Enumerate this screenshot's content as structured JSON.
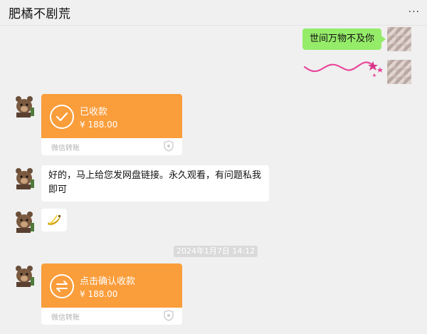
{
  "header": {
    "title": "肥橘不剧荒",
    "more_icon": "more-dots-icon",
    "more_label": "···"
  },
  "messages": {
    "sent_text": "世间万物不及你",
    "sticker_icon": "pink-star-squiggle-icon",
    "transfer1": {
      "label": "已收款",
      "amount": "¥ 188.00",
      "footer": "微信转账",
      "status_icon": "check-circle-icon"
    },
    "reply_text": "好的，马上给您发网盘链接。永久观看，有问题私我即可",
    "emoji_icon": "banana-emoji-icon",
    "timestamp": "2024年1月7日 14:12",
    "transfer2": {
      "label": "点击确认收款",
      "amount": "¥ 188.00",
      "footer": "微信转账",
      "status_icon": "exchange-arrows-icon"
    }
  },
  "colors": {
    "bubble_green": "#95ec69",
    "transfer_orange": "#fa9d3b",
    "background": "#f0f0f0"
  }
}
